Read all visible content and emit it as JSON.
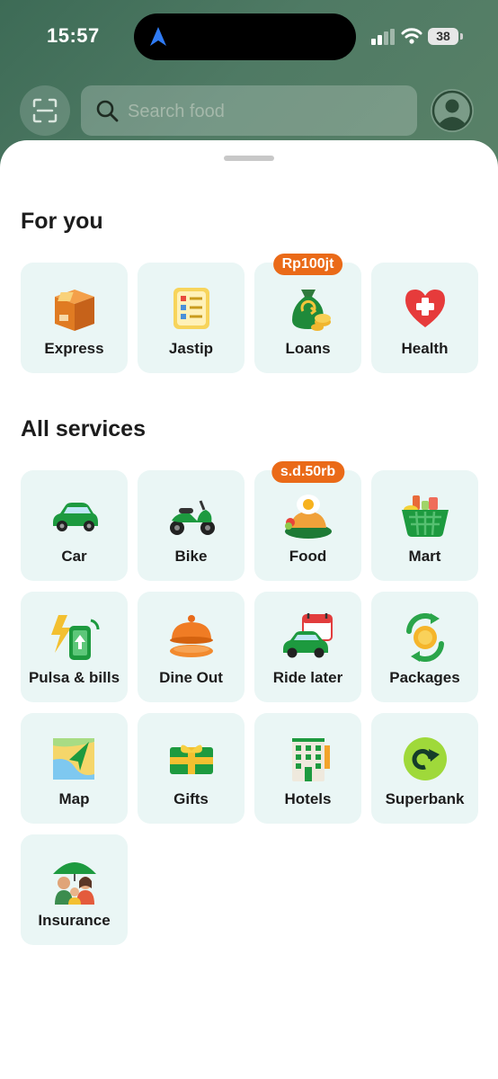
{
  "status_bar": {
    "time": "15:57",
    "battery": "38"
  },
  "header": {
    "search_placeholder": "Search food"
  },
  "for_you": {
    "title": "For you",
    "items": [
      {
        "label": "Express",
        "icon": "express-box-icon"
      },
      {
        "label": "Jastip",
        "icon": "jastip-checklist-icon"
      },
      {
        "label": "Loans",
        "icon": "loans-moneybag-icon",
        "badge": "Rp100jt"
      },
      {
        "label": "Health",
        "icon": "health-heart-icon"
      }
    ]
  },
  "all_services": {
    "title": "All services",
    "items": [
      {
        "label": "Car",
        "icon": "car-icon"
      },
      {
        "label": "Bike",
        "icon": "bike-icon"
      },
      {
        "label": "Food",
        "icon": "food-icon",
        "badge": "s.d.50rb"
      },
      {
        "label": "Mart",
        "icon": "mart-basket-icon"
      },
      {
        "label": "Pulsa & bills",
        "icon": "pulsa-phone-icon"
      },
      {
        "label": "Dine Out",
        "icon": "dine-out-cloche-icon"
      },
      {
        "label": "Ride later",
        "icon": "ride-later-car-calendar-icon"
      },
      {
        "label": "Packages",
        "icon": "packages-coin-icon"
      },
      {
        "label": "Map",
        "icon": "map-icon"
      },
      {
        "label": "Gifts",
        "icon": "gifts-icon"
      },
      {
        "label": "Hotels",
        "icon": "hotels-icon"
      },
      {
        "label": "Superbank",
        "icon": "superbank-icon"
      },
      {
        "label": "Insurance",
        "icon": "insurance-umbrella-icon"
      }
    ]
  },
  "colors": {
    "header_bg": "#4a755f",
    "tile_bg": "#eaf6f5",
    "badge": "#ea6a18",
    "brand_green": "#00a84f"
  }
}
